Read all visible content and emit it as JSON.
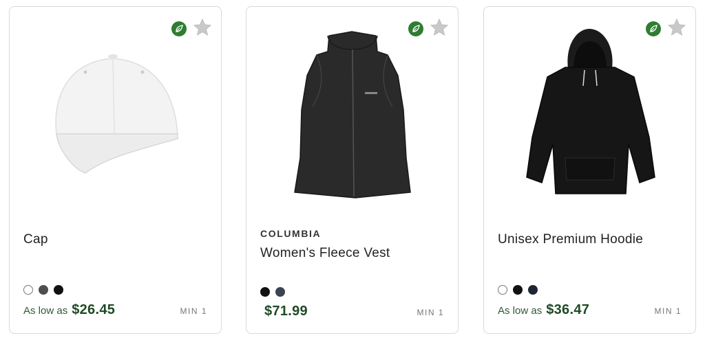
{
  "products": [
    {
      "brand": "",
      "title": "Cap",
      "swatches": [
        "white",
        "gray",
        "black"
      ],
      "price_prefix": "As low as",
      "price": "$26.45",
      "min": "MIN 1"
    },
    {
      "brand": "COLUMBIA",
      "title": "Women's Fleece Vest",
      "swatches": [
        "black",
        "slate"
      ],
      "price_prefix": "",
      "price": "$71.99",
      "min": "MIN 1"
    },
    {
      "brand": "",
      "title": "Unisex Premium Hoodie",
      "swatches": [
        "white",
        "black",
        "navy"
      ],
      "price_prefix": "As low as",
      "price": "$36.47",
      "min": "MIN 1"
    }
  ],
  "icons": {
    "eco": "leaf-icon",
    "favorite": "star-icon"
  },
  "colors": {
    "eco_badge": "#2e7d32",
    "price": "#1f4a25",
    "star": "#c9c9c9"
  }
}
